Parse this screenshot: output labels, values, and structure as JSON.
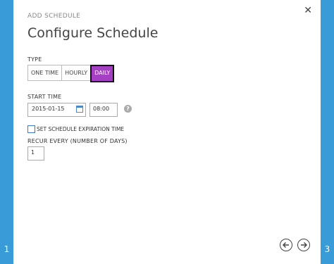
{
  "wizard": {
    "step_left": "1",
    "step_right": "3"
  },
  "dialog": {
    "subtitle": "ADD SCHEDULE",
    "title": "Configure Schedule",
    "close_icon": "close-icon"
  },
  "type": {
    "label": "TYPE",
    "options": [
      "ONE TIME",
      "HOURLY",
      "DAILY"
    ],
    "selected": "DAILY"
  },
  "start_time": {
    "label": "START TIME",
    "date": "2015-01-15",
    "time": "08:00",
    "help": "?"
  },
  "expiration": {
    "label": "SET SCHEDULE EXPIRATION TIME",
    "checked": false
  },
  "recur": {
    "label": "RECUR EVERY (NUMBER OF DAYS)",
    "value": "1"
  },
  "colors": {
    "side_bar": "#3a9bd9",
    "selected_option": "#a53fc4"
  }
}
